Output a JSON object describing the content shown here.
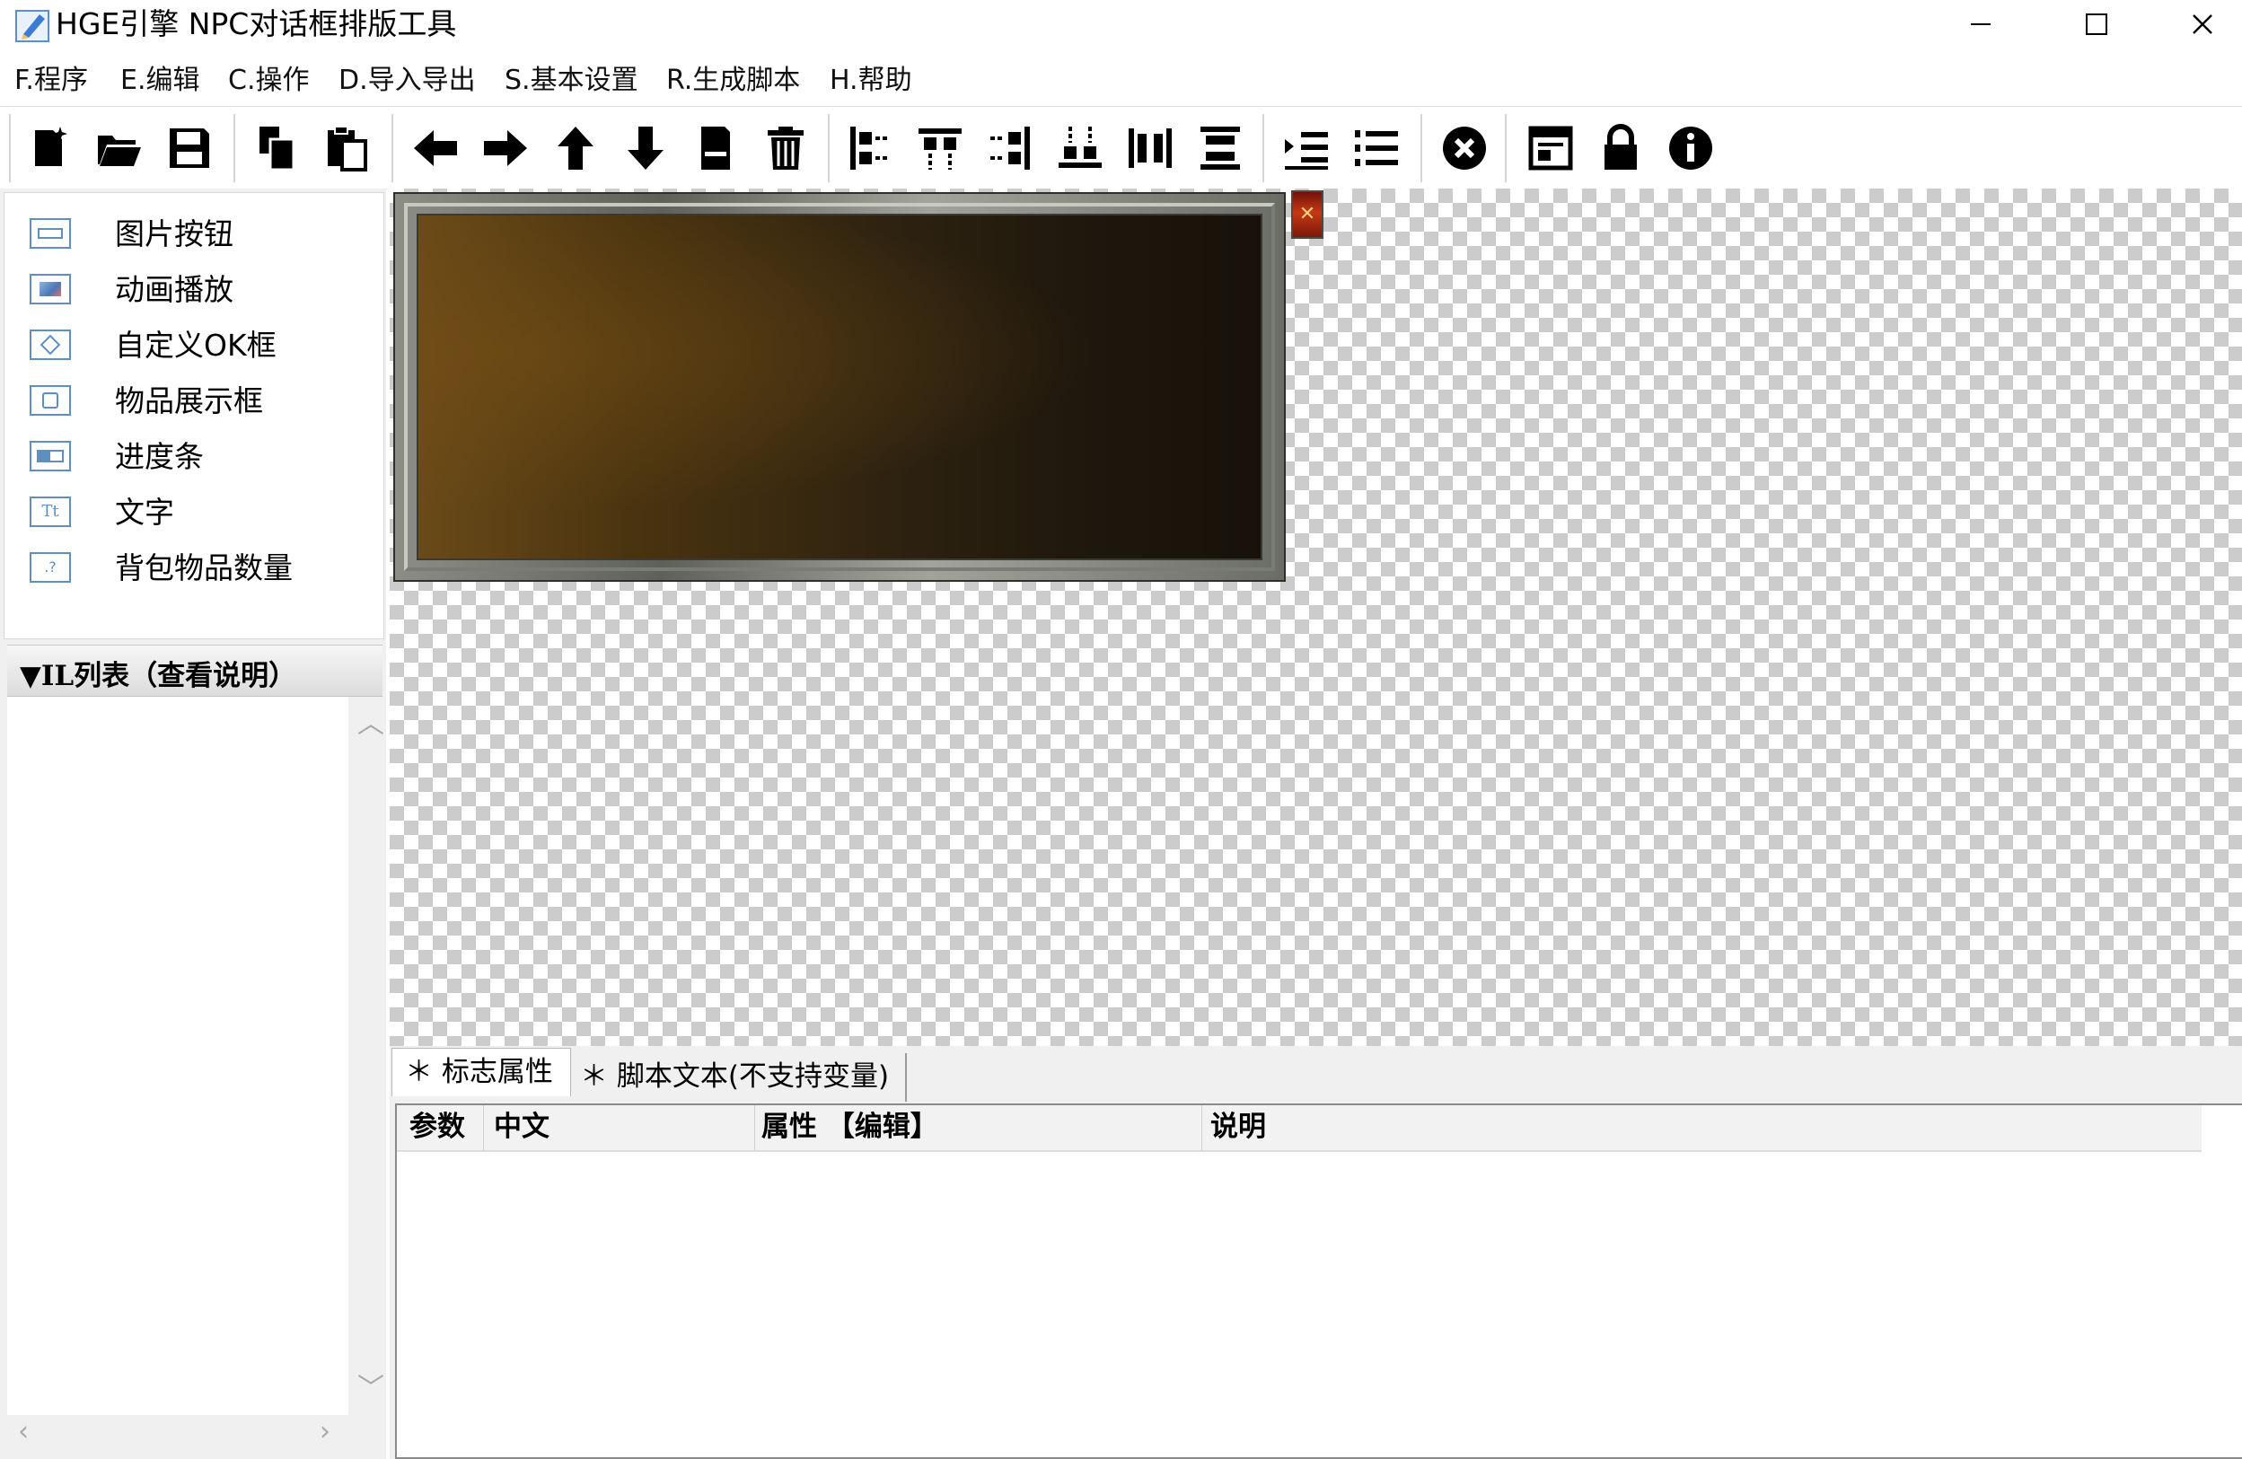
{
  "window": {
    "title": "HGE引擎 NPC对话框排版工具",
    "minimize_glyph": "—",
    "close_glyph": "✕"
  },
  "menu": [
    {
      "label": "F.程序"
    },
    {
      "label": "E.编辑"
    },
    {
      "label": "C.操作"
    },
    {
      "label": "D.导入导出"
    },
    {
      "label": "S.基本设置"
    },
    {
      "label": "R.生成脚本"
    },
    {
      "label": "H.帮助"
    }
  ],
  "toolbar": {
    "icons": [
      "new-file-icon",
      "open-folder-icon",
      "save-icon",
      "copy-icon",
      "paste-icon",
      "arrow-left-icon",
      "arrow-right-icon",
      "arrow-up-icon",
      "arrow-down-icon",
      "minimize-icon",
      "delete-icon",
      "align-left-icon",
      "align-top-icon",
      "align-right-icon",
      "align-bottom-icon",
      "distribute-horizontal-icon",
      "distribute-vertical-icon",
      "indent-icon",
      "numbered-list-icon",
      "close-circle-icon",
      "window-icon",
      "lock-icon",
      "info-icon"
    ]
  },
  "palette": {
    "items": [
      {
        "label": "图片按钮",
        "icon": "image-button-icon"
      },
      {
        "label": "动画播放",
        "icon": "animation-icon"
      },
      {
        "label": "自定义OK框",
        "icon": "custom-ok-box-icon"
      },
      {
        "label": "物品展示框",
        "icon": "item-display-icon"
      },
      {
        "label": "进度条",
        "icon": "progress-bar-icon"
      },
      {
        "label": "文字",
        "icon": "text-icon"
      },
      {
        "label": "背包物品数量",
        "icon": "bag-item-count-icon"
      }
    ]
  },
  "wil_list": {
    "title": "▼IL列表（查看说明）"
  },
  "canvas": {
    "dialog_close_glyph": "✕"
  },
  "bottom": {
    "tabs": [
      {
        "label": "＊ 标志属性",
        "active": true
      },
      {
        "label": "＊ 脚本文本(不支持变量)",
        "active": false
      }
    ],
    "grid_headers": {
      "param": "参数",
      "chinese": "中文",
      "property": "属性 【编辑】",
      "description": "说明"
    }
  }
}
